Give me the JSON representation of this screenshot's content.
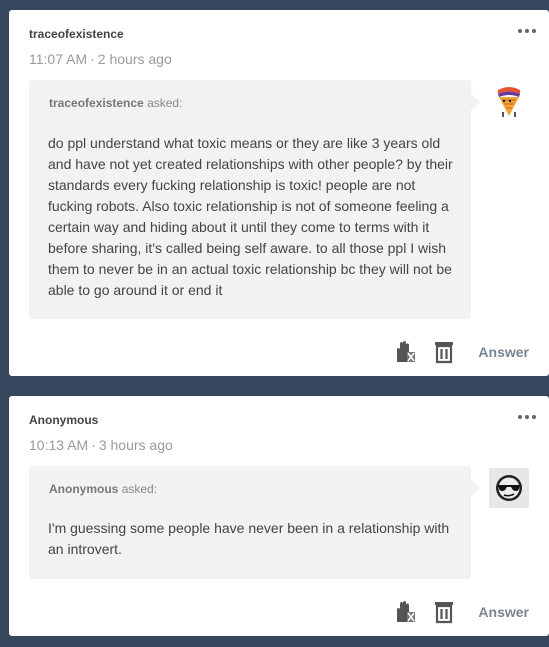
{
  "posts": [
    {
      "username": "traceofexistence",
      "time": "11:07 AM",
      "ago": "2 hours ago",
      "asker_name": "traceofexistence",
      "asked_label": "asked:",
      "question": "do ppl understand what toxic means or they are like 3 years old and have not yet created relationships with other people? by their standards every fucking relationship is toxic! people are not fucking robots. Also toxic relationship is not of someone feeling a certain way and hiding about it until they come to terms with it before sharing, it's called being self aware. to all those ppl I wish them to never be in an actual toxic relationship bc they will not be able to go around it or end it",
      "avatar_icon": "ice-cream-cone-avatar",
      "actions": {
        "block_icon": "hand-block-icon",
        "delete_icon": "trash-icon",
        "answer_label": "Answer"
      }
    },
    {
      "username": "Anonymous",
      "time": "10:13 AM",
      "ago": "3 hours ago",
      "asker_name": "Anonymous",
      "asked_label": "asked:",
      "question": "I'm guessing some people have never been in a relationship with an introvert.",
      "avatar_icon": "sunglasses-face-avatar",
      "actions": {
        "block_icon": "hand-block-icon",
        "delete_icon": "trash-icon",
        "answer_label": "Answer"
      }
    }
  ],
  "colors": {
    "background": "#36465d",
    "card": "#ffffff",
    "bubble": "#f2f2f2",
    "answer_text": "#7a8590"
  }
}
